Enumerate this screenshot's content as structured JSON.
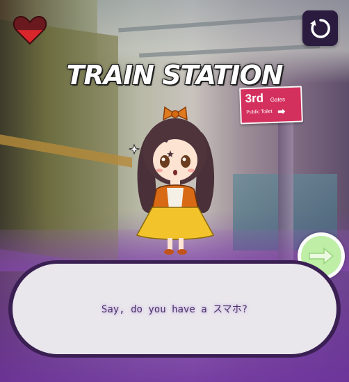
{
  "scene": {
    "title": "TRAIN STATION",
    "sign": {
      "main": "3rd",
      "sub": "Gates",
      "small": "Public Toilet"
    }
  },
  "hud": {
    "health_icon": "heart-icon",
    "reset_icon": "restart-icon"
  },
  "dialog": {
    "text": "Say, do you have a スマホ?"
  },
  "controls": {
    "next_icon": "arrow-right-icon"
  },
  "colors": {
    "heart": "#d8262b",
    "reset_bg": "#2a1b3f",
    "next_btn": "#bfeea6",
    "dialog_bg": "#e9e6ec",
    "dialog_border": "#3a1f53",
    "sign_bg": "#d4305e"
  }
}
